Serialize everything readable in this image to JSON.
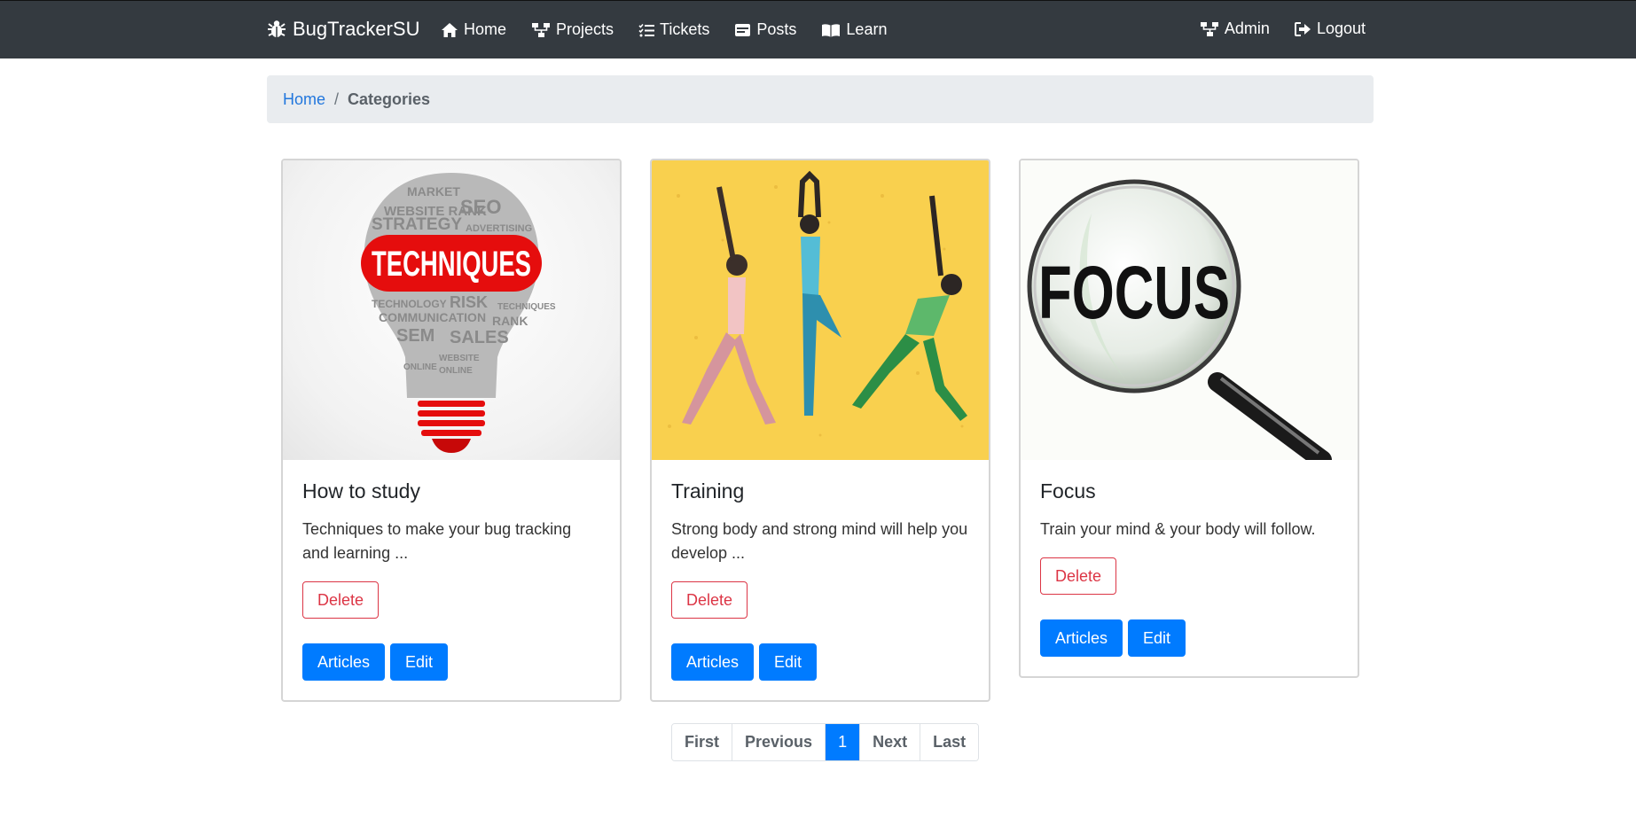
{
  "navbar": {
    "brand": "BugTrackerSU",
    "links": [
      {
        "label": "Home",
        "icon": "home-icon"
      },
      {
        "label": "Projects",
        "icon": "sitemap-icon"
      },
      {
        "label": "Tickets",
        "icon": "tasks-icon"
      },
      {
        "label": "Posts",
        "icon": "window-icon"
      },
      {
        "label": "Learn",
        "icon": "book-icon"
      }
    ],
    "right_links": [
      {
        "label": "Admin",
        "icon": "sitemap-icon"
      },
      {
        "label": "Logout",
        "icon": "logout-icon"
      }
    ]
  },
  "breadcrumb": {
    "home": "Home",
    "separator": "/",
    "current": "Categories"
  },
  "cards": [
    {
      "image_text": "TECHNIQUES",
      "title": "How to study",
      "text": "Techniques to make your bug tracking and learning ...",
      "delete_label": "Delete",
      "articles_label": "Articles",
      "edit_label": "Edit"
    },
    {
      "title": "Training",
      "text": "Strong body and strong mind will help you develop ...",
      "delete_label": "Delete",
      "articles_label": "Articles",
      "edit_label": "Edit"
    },
    {
      "image_text": "FOCUS",
      "title": "Focus",
      "text": "Train your mind & your body will follow.",
      "delete_label": "Delete",
      "articles_label": "Articles",
      "edit_label": "Edit"
    }
  ],
  "pagination": {
    "first": "First",
    "previous": "Previous",
    "current": "1",
    "next": "Next",
    "last": "Last"
  },
  "colors": {
    "navbar": "#343a40",
    "primary": "#007bff",
    "danger": "#dc3545",
    "breadcrumb_bg": "#e9ecef"
  }
}
